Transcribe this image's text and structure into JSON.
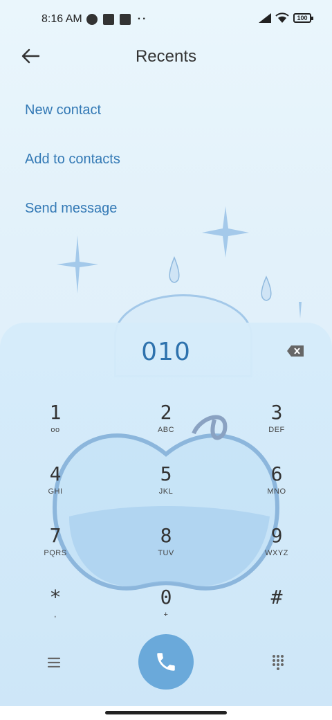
{
  "status_bar": {
    "time": "8:16 AM",
    "left_icons": [
      "vpn-icon",
      "square-icon",
      "upload-icon"
    ],
    "more": "··",
    "right_icons": [
      "signal-icon",
      "wifi-icon"
    ],
    "battery": "100"
  },
  "header": {
    "title": "Recents",
    "back_icon": "arrow-left-icon"
  },
  "actions": {
    "new_contact": "New contact",
    "add_to_contacts": "Add to contacts",
    "send_message": "Send message"
  },
  "dialer": {
    "number": "010",
    "delete_icon": "backspace-icon",
    "keys": [
      {
        "digit": "1",
        "sub": "oo"
      },
      {
        "digit": "2",
        "sub": "ABC"
      },
      {
        "digit": "3",
        "sub": "DEF"
      },
      {
        "digit": "4",
        "sub": "GHI"
      },
      {
        "digit": "5",
        "sub": "JKL"
      },
      {
        "digit": "6",
        "sub": "MNO"
      },
      {
        "digit": "7",
        "sub": "PQRS"
      },
      {
        "digit": "8",
        "sub": "TUV"
      },
      {
        "digit": "9",
        "sub": "WXYZ"
      },
      {
        "digit": "*",
        "sub": ","
      },
      {
        "digit": "0",
        "sub": "+"
      },
      {
        "digit": "#",
        "sub": ""
      }
    ],
    "menu_icon": "menu-icon",
    "call_icon": "phone-icon",
    "dialpad_icon": "dialpad-icon",
    "accent_color": "#6aa9da"
  }
}
